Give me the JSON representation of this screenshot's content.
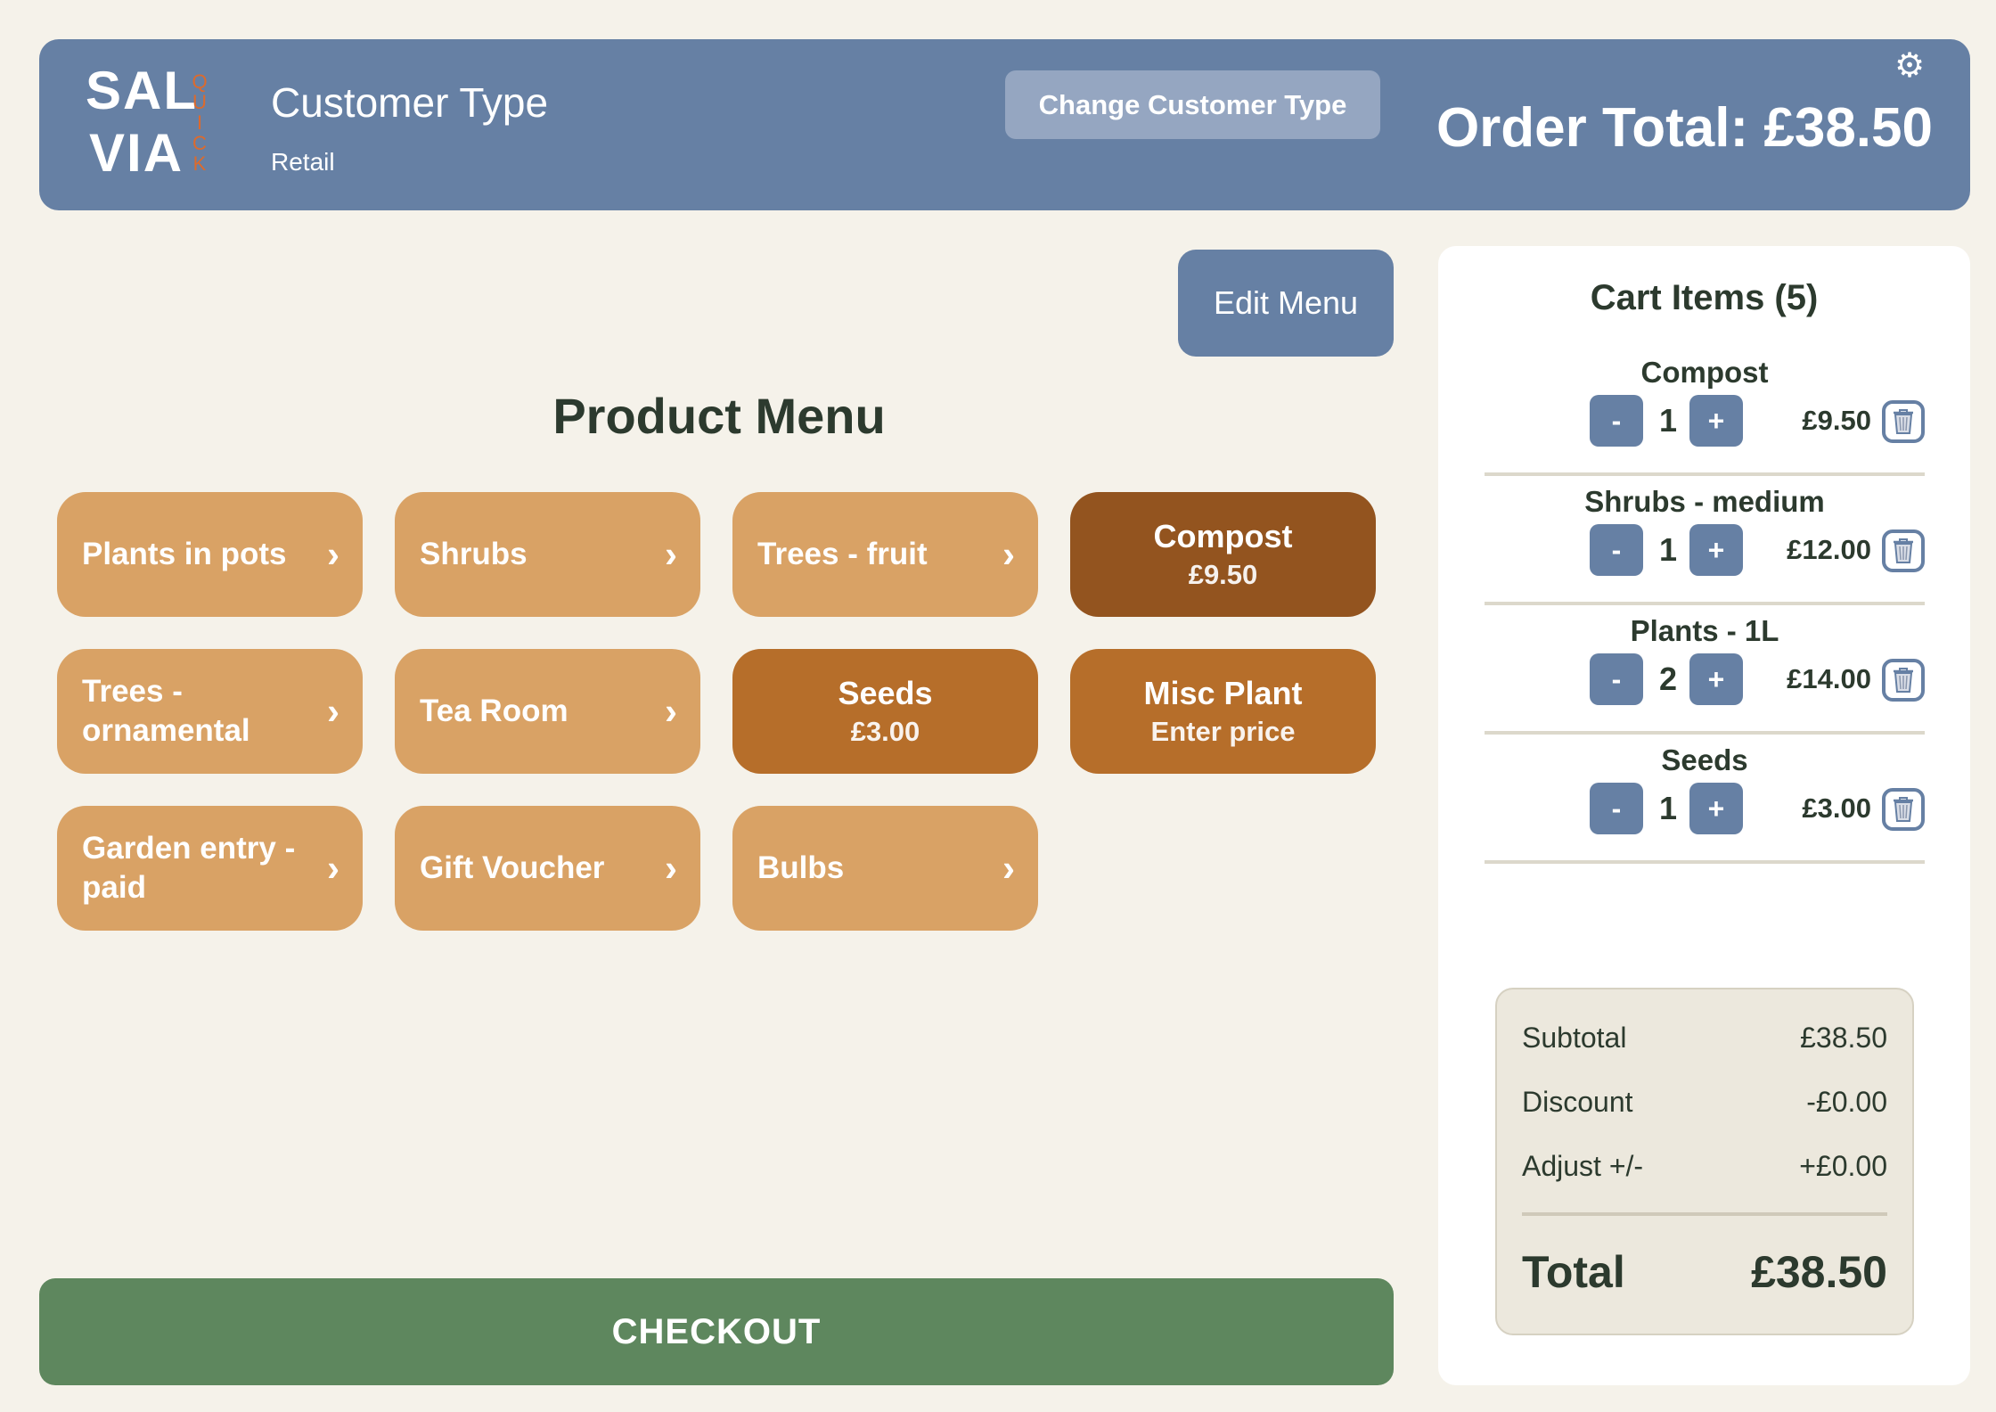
{
  "header": {
    "logo": {
      "line1": "SAL",
      "line2": "VIA",
      "vertical": "QUICK"
    },
    "customer_type_title": "Customer Type",
    "customer_type_value": "Retail",
    "change_button": "Change Customer Type",
    "order_total": "Order Total: £38.50",
    "settings_icon": "gear-icon"
  },
  "edit_menu_label": "Edit Menu",
  "menu_title": "Product Menu",
  "tiles": [
    {
      "kind": "category",
      "label": "Plants in pots"
    },
    {
      "kind": "category",
      "label": "Shrubs"
    },
    {
      "kind": "category",
      "label": "Trees - fruit"
    },
    {
      "kind": "product",
      "label": "Compost",
      "price": "£9.50"
    },
    {
      "kind": "category",
      "label": "Trees - ornamental"
    },
    {
      "kind": "category",
      "label": "Tea Room"
    },
    {
      "kind": "product",
      "label": "Seeds",
      "price": "£3.00"
    },
    {
      "kind": "product",
      "label": "Misc Plant",
      "price": "Enter price"
    },
    {
      "kind": "category",
      "label": "Garden entry - paid"
    },
    {
      "kind": "category",
      "label": "Gift Voucher"
    },
    {
      "kind": "category",
      "label": "Bulbs"
    }
  ],
  "chevron": "›",
  "checkout_label": "CHECKOUT",
  "cart": {
    "title": "Cart Items (5)",
    "minus": "-",
    "plus": "+",
    "items": [
      {
        "name": "Compost",
        "qty": "1",
        "price": "£9.50"
      },
      {
        "name": "Shrubs - medium",
        "qty": "1",
        "price": "£12.00"
      },
      {
        "name": "Plants - 1L",
        "qty": "2",
        "price": "£14.00"
      },
      {
        "name": "Seeds",
        "qty": "1",
        "price": "£3.00"
      }
    ]
  },
  "summary": {
    "subtotal_label": "Subtotal",
    "subtotal_value": "£38.50",
    "discount_label": "Discount",
    "discount_value": "-£0.00",
    "adjust_label": "Adjust +/-",
    "adjust_value": "+£0.00",
    "total_label": "Total",
    "total_value": "£38.50"
  },
  "colors": {
    "header_bg": "#6680a4",
    "category_tile": "#d9a265",
    "product_tile": "#b66e2a",
    "product_tile_dark": "#93541f",
    "checkout": "#5e875e",
    "page_bg": "#f5f2ea",
    "logo_accent": "#dd6a2c"
  }
}
